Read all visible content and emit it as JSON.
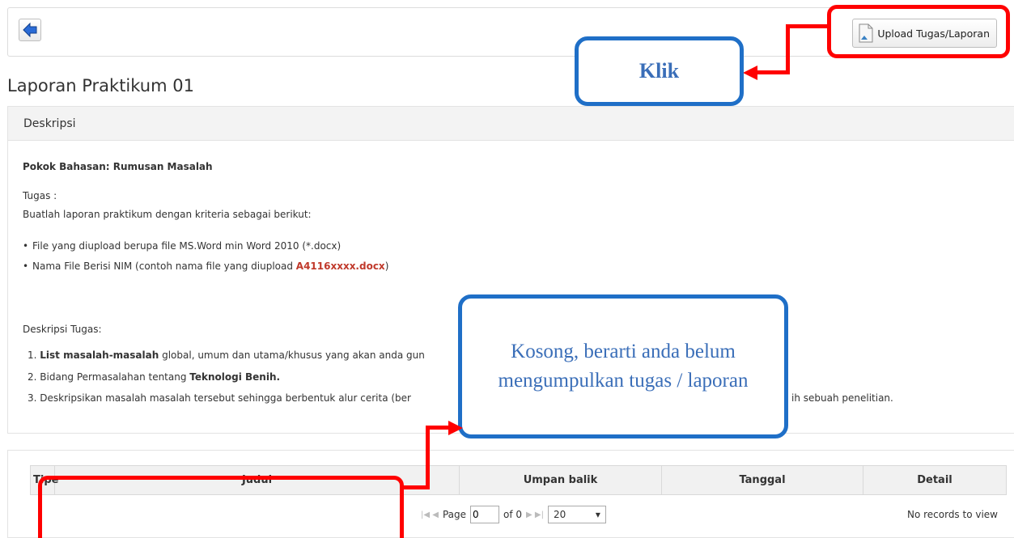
{
  "toolbar": {
    "back_icon": "back-arrow-icon",
    "upload_label": "Upload Tugas/Laporan",
    "upload_icon": "document-upload-icon"
  },
  "page": {
    "title": "Laporan Praktikum 01"
  },
  "description_panel": {
    "header": "Deskripsi",
    "pokok_bahasan": "Pokok Bahasan: Rumusan Masalah",
    "tugas_label": "Tugas :",
    "intro": "Buatlah laporan praktikum dengan kriteria sebagai berikut:",
    "criteria": [
      {
        "text": "File yang diupload berupa file MS.Word min Word 2010 (*.docx)",
        "highlight": ""
      },
      {
        "text": "Nama File Berisi NIM (contoh nama file yang diupload ",
        "highlight": "A4116xxxx.docx",
        "suffix": ")"
      }
    ],
    "deskripsi_label": "Deskripsi Tugas:",
    "tasks": [
      {
        "num": "1.",
        "bold": "List masalah-masalah",
        "rest": " global, umum dan utama/khusus yang akan anda gun"
      },
      {
        "num": "2.",
        "pre": "Bidang Permasalahan tentang ",
        "bold": "Teknologi Benih."
      },
      {
        "num": "3.",
        "text": "Deskripsikan masalah masalah tersebut sehingga berbentuk alur cerita (ber",
        "tail": "ih sebuah penelitian."
      }
    ]
  },
  "grid": {
    "columns": [
      "Tipe",
      "Judul",
      "Umpan balik",
      "Tanggal",
      "Detail"
    ],
    "pager": {
      "page_label": "Page",
      "page_value": "0",
      "of_label": "of 0",
      "page_size": "20"
    },
    "empty_text": "No records to view"
  },
  "annotations": {
    "klik": "Klik",
    "kosong": "Kosong, berarti anda belum mengumpulkan tugas / laporan"
  },
  "colors": {
    "highlight_red": "#ff0000",
    "callout_blue": "#1f6fc7"
  }
}
